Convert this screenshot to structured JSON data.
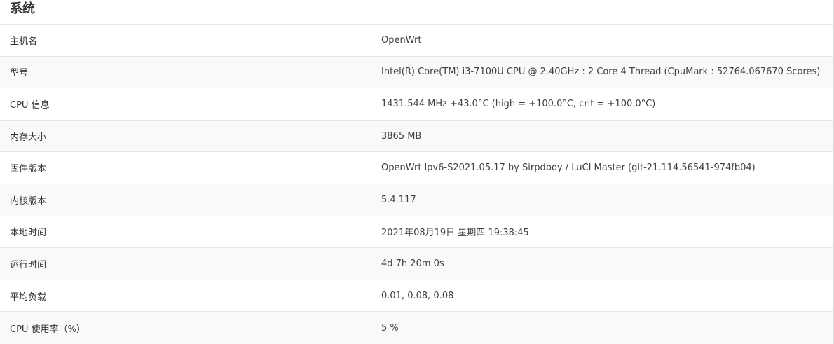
{
  "section": {
    "title": "系统"
  },
  "rows": [
    {
      "label": "主机名",
      "value": "OpenWrt"
    },
    {
      "label": "型号",
      "value": "Intel(R) Core(TM) i3-7100U CPU @ 2.40GHz : 2 Core 4 Thread (CpuMark : 52764.067670 Scores)"
    },
    {
      "label": "CPU 信息",
      "value": "1431.544 MHz +43.0°C (high = +100.0°C, crit = +100.0°C)"
    },
    {
      "label": "内存大小",
      "value": "3865 MB"
    },
    {
      "label": "固件版本",
      "value": "OpenWrt lpv6-S2021.05.17 by Sirpdboy / LuCI Master (git-21.114.56541-974fb04)"
    },
    {
      "label": "内核版本",
      "value": "5.4.117"
    },
    {
      "label": "本地时间",
      "value": "2021年08月19日 星期四 19:38:45"
    },
    {
      "label": "运行时间",
      "value": "4d 7h 20m 0s"
    },
    {
      "label": "平均负载",
      "value": "0.01, 0.08, 0.08"
    },
    {
      "label": "CPU 使用率（%）",
      "value": "5 %"
    }
  ]
}
